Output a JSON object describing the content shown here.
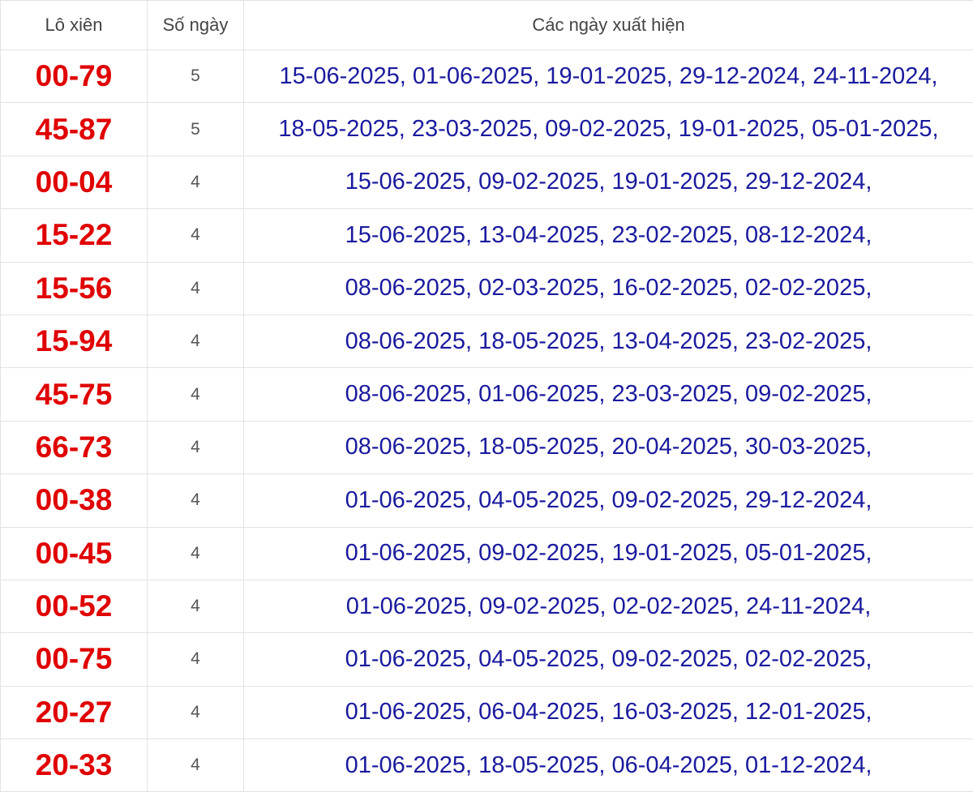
{
  "header": {
    "col_pair": "Lô xiên",
    "col_count": "Số ngày",
    "col_dates": "Các ngày xuất hiện"
  },
  "rows": [
    {
      "pair": "00-79",
      "count": "5",
      "dates": "15-06-2025, 01-06-2025, 19-01-2025, 29-12-2024, 24-11-2024,"
    },
    {
      "pair": "45-87",
      "count": "5",
      "dates": "18-05-2025, 23-03-2025, 09-02-2025, 19-01-2025, 05-01-2025,"
    },
    {
      "pair": "00-04",
      "count": "4",
      "dates": "15-06-2025, 09-02-2025, 19-01-2025, 29-12-2024,"
    },
    {
      "pair": "15-22",
      "count": "4",
      "dates": "15-06-2025, 13-04-2025, 23-02-2025, 08-12-2024,"
    },
    {
      "pair": "15-56",
      "count": "4",
      "dates": "08-06-2025, 02-03-2025, 16-02-2025, 02-02-2025,"
    },
    {
      "pair": "15-94",
      "count": "4",
      "dates": "08-06-2025, 18-05-2025, 13-04-2025, 23-02-2025,"
    },
    {
      "pair": "45-75",
      "count": "4",
      "dates": "08-06-2025, 01-06-2025, 23-03-2025, 09-02-2025,"
    },
    {
      "pair": "66-73",
      "count": "4",
      "dates": "08-06-2025, 18-05-2025, 20-04-2025, 30-03-2025,"
    },
    {
      "pair": "00-38",
      "count": "4",
      "dates": "01-06-2025, 04-05-2025, 09-02-2025, 29-12-2024,"
    },
    {
      "pair": "00-45",
      "count": "4",
      "dates": "01-06-2025, 09-02-2025, 19-01-2025, 05-01-2025,"
    },
    {
      "pair": "00-52",
      "count": "4",
      "dates": "01-06-2025, 09-02-2025, 02-02-2025, 24-11-2024,"
    },
    {
      "pair": "00-75",
      "count": "4",
      "dates": "01-06-2025, 04-05-2025, 09-02-2025, 02-02-2025,"
    },
    {
      "pair": "20-27",
      "count": "4",
      "dates": "01-06-2025, 06-04-2025, 16-03-2025, 12-01-2025,"
    },
    {
      "pair": "20-33",
      "count": "4",
      "dates": "01-06-2025, 18-05-2025, 06-04-2025, 01-12-2024,"
    }
  ],
  "colors": {
    "pair_text": "#e00000",
    "date_text": "#1a1a9e",
    "count_text": "#555555",
    "header_text": "#444444",
    "accent": "#cc0000",
    "border": "#e2e2e2"
  }
}
